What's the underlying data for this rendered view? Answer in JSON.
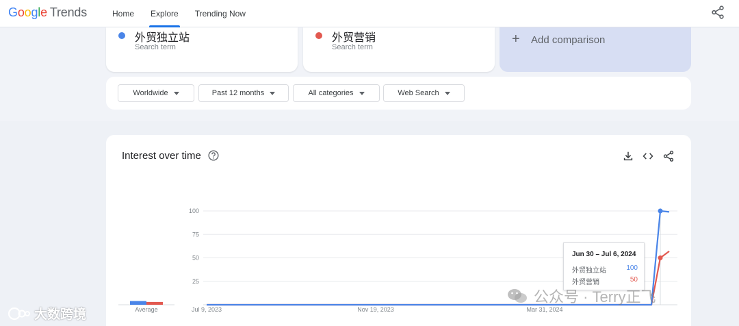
{
  "header": {
    "logo_google": [
      "G",
      "o",
      "o",
      "g",
      "l",
      "e"
    ],
    "logo_trends": "Trends",
    "nav": [
      "Home",
      "Explore",
      "Trending Now"
    ],
    "active_nav": "Explore"
  },
  "terms": [
    {
      "title": "外贸独立站",
      "subtitle": "Search term",
      "color": "#4a85e8"
    },
    {
      "title": "外贸营销",
      "subtitle": "Search term",
      "color": "#e25950"
    }
  ],
  "add_comparison": "Add comparison",
  "filters": [
    "Worldwide",
    "Past 12 months",
    "All categories",
    "Web Search"
  ],
  "card": {
    "title": "Interest over time"
  },
  "chart_data": {
    "type": "line",
    "title": "Interest over time",
    "xlabel": "",
    "ylabel": "",
    "ylim": [
      0,
      100
    ],
    "yticks": [
      "100",
      "75",
      "50",
      "25"
    ],
    "x_tick_labels": [
      "Jul 9, 2023",
      "Nov 19, 2023",
      "Mar 31, 2024"
    ],
    "average_label": "Average",
    "average": [
      {
        "name": "外贸独立站",
        "value": 4
      },
      {
        "name": "外贸营销",
        "value": 3
      }
    ],
    "x_weeks": [
      "2023-07-09",
      "2023-07-16",
      "2023-07-23",
      "2023-07-30",
      "2023-08-06",
      "2023-08-13",
      "2023-08-20",
      "2023-08-27",
      "2023-09-03",
      "2023-09-10",
      "2023-09-17",
      "2023-09-24",
      "2023-10-01",
      "2023-10-08",
      "2023-10-15",
      "2023-10-22",
      "2023-10-29",
      "2023-11-05",
      "2023-11-12",
      "2023-11-19",
      "2023-11-26",
      "2023-12-03",
      "2023-12-10",
      "2023-12-17",
      "2023-12-24",
      "2023-12-31",
      "2024-01-07",
      "2024-01-14",
      "2024-01-21",
      "2024-01-28",
      "2024-02-04",
      "2024-02-11",
      "2024-02-18",
      "2024-02-25",
      "2024-03-03",
      "2024-03-10",
      "2024-03-17",
      "2024-03-24",
      "2024-03-31",
      "2024-04-07",
      "2024-04-14",
      "2024-04-21",
      "2024-04-28",
      "2024-05-05",
      "2024-05-12",
      "2024-05-19",
      "2024-05-26",
      "2024-06-02",
      "2024-06-09",
      "2024-06-16",
      "2024-06-23",
      "2024-06-30",
      "2024-07-07"
    ],
    "series": [
      {
        "name": "外贸独立站",
        "color": "#4a85e8",
        "values": [
          0,
          0,
          0,
          0,
          0,
          0,
          0,
          0,
          0,
          0,
          0,
          0,
          0,
          0,
          0,
          0,
          0,
          0,
          0,
          0,
          0,
          0,
          0,
          0,
          0,
          0,
          0,
          0,
          0,
          0,
          0,
          0,
          0,
          0,
          0,
          0,
          0,
          0,
          0,
          0,
          0,
          0,
          0,
          0,
          0,
          0,
          0,
          0,
          0,
          0,
          0,
          100,
          99
        ]
      },
      {
        "name": "外贸营销",
        "color": "#e25950",
        "values": [
          0,
          0,
          0,
          0,
          0,
          0,
          0,
          0,
          0,
          0,
          0,
          0,
          0,
          0,
          0,
          0,
          0,
          0,
          0,
          0,
          0,
          0,
          0,
          0,
          0,
          0,
          0,
          0,
          0,
          0,
          0,
          0,
          0,
          0,
          0,
          0,
          0,
          0,
          0,
          0,
          0,
          0,
          0,
          0,
          0,
          0,
          0,
          0,
          0,
          0,
          0,
          50,
          57
        ]
      }
    ],
    "grid": true,
    "legend": "none",
    "tooltip": {
      "date": "Jun 30 – Jul 6, 2024",
      "rows": [
        {
          "name": "外贸独立站",
          "value": "100",
          "color": "#4a85e8"
        },
        {
          "name": "外贸营销",
          "value": "50",
          "color": "#e25950"
        }
      ]
    }
  },
  "watermarks": {
    "left": "大数跨境",
    "right": "公众号 · Terry正飞"
  }
}
